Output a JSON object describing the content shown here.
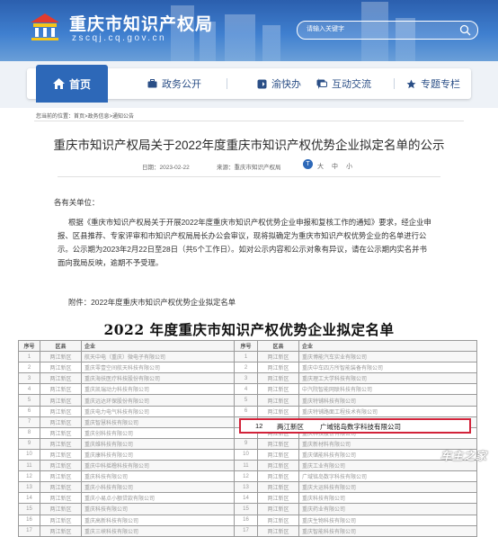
{
  "header": {
    "site_title": "重庆市知识产权局",
    "site_domain": "zscqj.cq.gov.cn",
    "search_placeholder": "请输入关键字"
  },
  "nav": {
    "items": [
      {
        "label": "首页",
        "icon": "home-icon"
      },
      {
        "label": "政务公开",
        "icon": "briefcase-icon"
      },
      {
        "label": "渝快办",
        "icon": "arrow-box-icon"
      },
      {
        "label": "互动交流",
        "icon": "chat-icon"
      },
      {
        "label": "专题专栏",
        "icon": "star-icon"
      }
    ]
  },
  "breadcrumb": "您当前的位置：首页>政务信息>通知公告",
  "article": {
    "title": "重庆市知识产权局关于2022年度重庆市知识产权优势企业拟定名单的公示",
    "date": "日期：2023-02-22",
    "source": "来源：重庆市知识产权局",
    "font_badge": "T",
    "font_sizes": [
      "大",
      "中",
      "小"
    ],
    "greeting": "各有关单位：",
    "body_lines": [
      "根据《重庆市知识产权局关于开展2022年度重庆市知识产权优势企业申报和复核工作的通知》要求，经企业申",
      "报、区县推荐、专家评审和市知识产权局局长办公会审议，现将拟确定为重庆市知识产权优势企业的名单进行公",
      "示。公示期为2023年2月22日至28日（共5个工作日）。如对公示内容和公示对象有异议，请在公示期内实名并书",
      "面向我局反映，逾期不予受理。"
    ],
    "attachment": "附件：2022年度重庆市知识产权优势企业拟定名单"
  },
  "list_image": {
    "title": "2022 年度重庆市知识产权优势企业拟定名单",
    "headers": [
      "序号",
      "区县",
      "企业",
      "序号",
      "区县",
      "企业"
    ],
    "rows": [
      [
        "1",
        "两江新区",
        "航天中电（重庆）微电子有限公司",
        "1",
        "两江新区",
        "重庆博能汽车实业有限公司"
      ],
      [
        "2",
        "两江新区",
        "重庆零壹空间航天科技有限公司",
        "2",
        "两江新区",
        "重庆中车四方所智能装备有限公司"
      ],
      [
        "3",
        "两江新区",
        "重庆海扶医疗科技股份有限公司",
        "3",
        "两江新区",
        "重庆理工大学科技有限公司"
      ],
      [
        "4",
        "两江新区",
        "重庆凯瑞动力科技有限公司",
        "4",
        "两江新区",
        "中汽院智能网联科技有限公司"
      ],
      [
        "5",
        "两江新区",
        "重庆远达环保股份有限公司",
        "5",
        "两江新区",
        "重庆特铺科技有限公司"
      ],
      [
        "6",
        "两江新区",
        "重庆电力电气科技有限公司",
        "6",
        "两江新区",
        "重庆特铺路面工程技术有限公司"
      ],
      [
        "7",
        "两江新区",
        "重庆智慧科技有限公司",
        "7",
        "两江新区",
        "重庆科技发展有限公司"
      ],
      [
        "8",
        "两江新区",
        "重庆创科技有限公司",
        "8",
        "两江新区",
        "重庆科技股份有限公司"
      ],
      [
        "9",
        "两江新区",
        "重庆维科技有限公司",
        "9",
        "两江新区",
        "重庆新材料有限公司"
      ],
      [
        "10",
        "两江新区",
        "重庆康科技有限公司",
        "10",
        "两江新区",
        "重庆储能科技有限公司"
      ],
      [
        "11",
        "两江新区",
        "重庆中科摇橹科技有限公司",
        "11",
        "两江新区",
        "重庆工业有限公司"
      ],
      [
        "12",
        "两江新区",
        "重庆科技有限公司",
        "12",
        "两江新区",
        "广域铭岛数字科技有限公司"
      ],
      [
        "13",
        "两江新区",
        "重庆小科技有限公司",
        "13",
        "两江新区",
        "重庆大运科技有限公司"
      ],
      [
        "14",
        "两江新区",
        "重庆小易点小额贷款有限公司",
        "14",
        "两江新区",
        "重庆科技有限公司"
      ],
      [
        "15",
        "两江新区",
        "重庆科技有限公司",
        "15",
        "两江新区",
        "重庆药业有限公司"
      ],
      [
        "16",
        "两江新区",
        "重庆高新科技有限公司",
        "16",
        "两江新区",
        "重庆生物科技有限公司"
      ],
      [
        "17",
        "两江新区",
        "重庆三峡科技有限公司",
        "17",
        "两江新区",
        "重庆智能科技有限公司"
      ]
    ],
    "highlight": {
      "no": "12",
      "district": "两江新区",
      "company": "广域铭岛数字科技有限公司"
    }
  },
  "watermark": "车主之家",
  "colors": {
    "brand_blue": "#2d68b8",
    "highlight_red": "#d2233a"
  }
}
